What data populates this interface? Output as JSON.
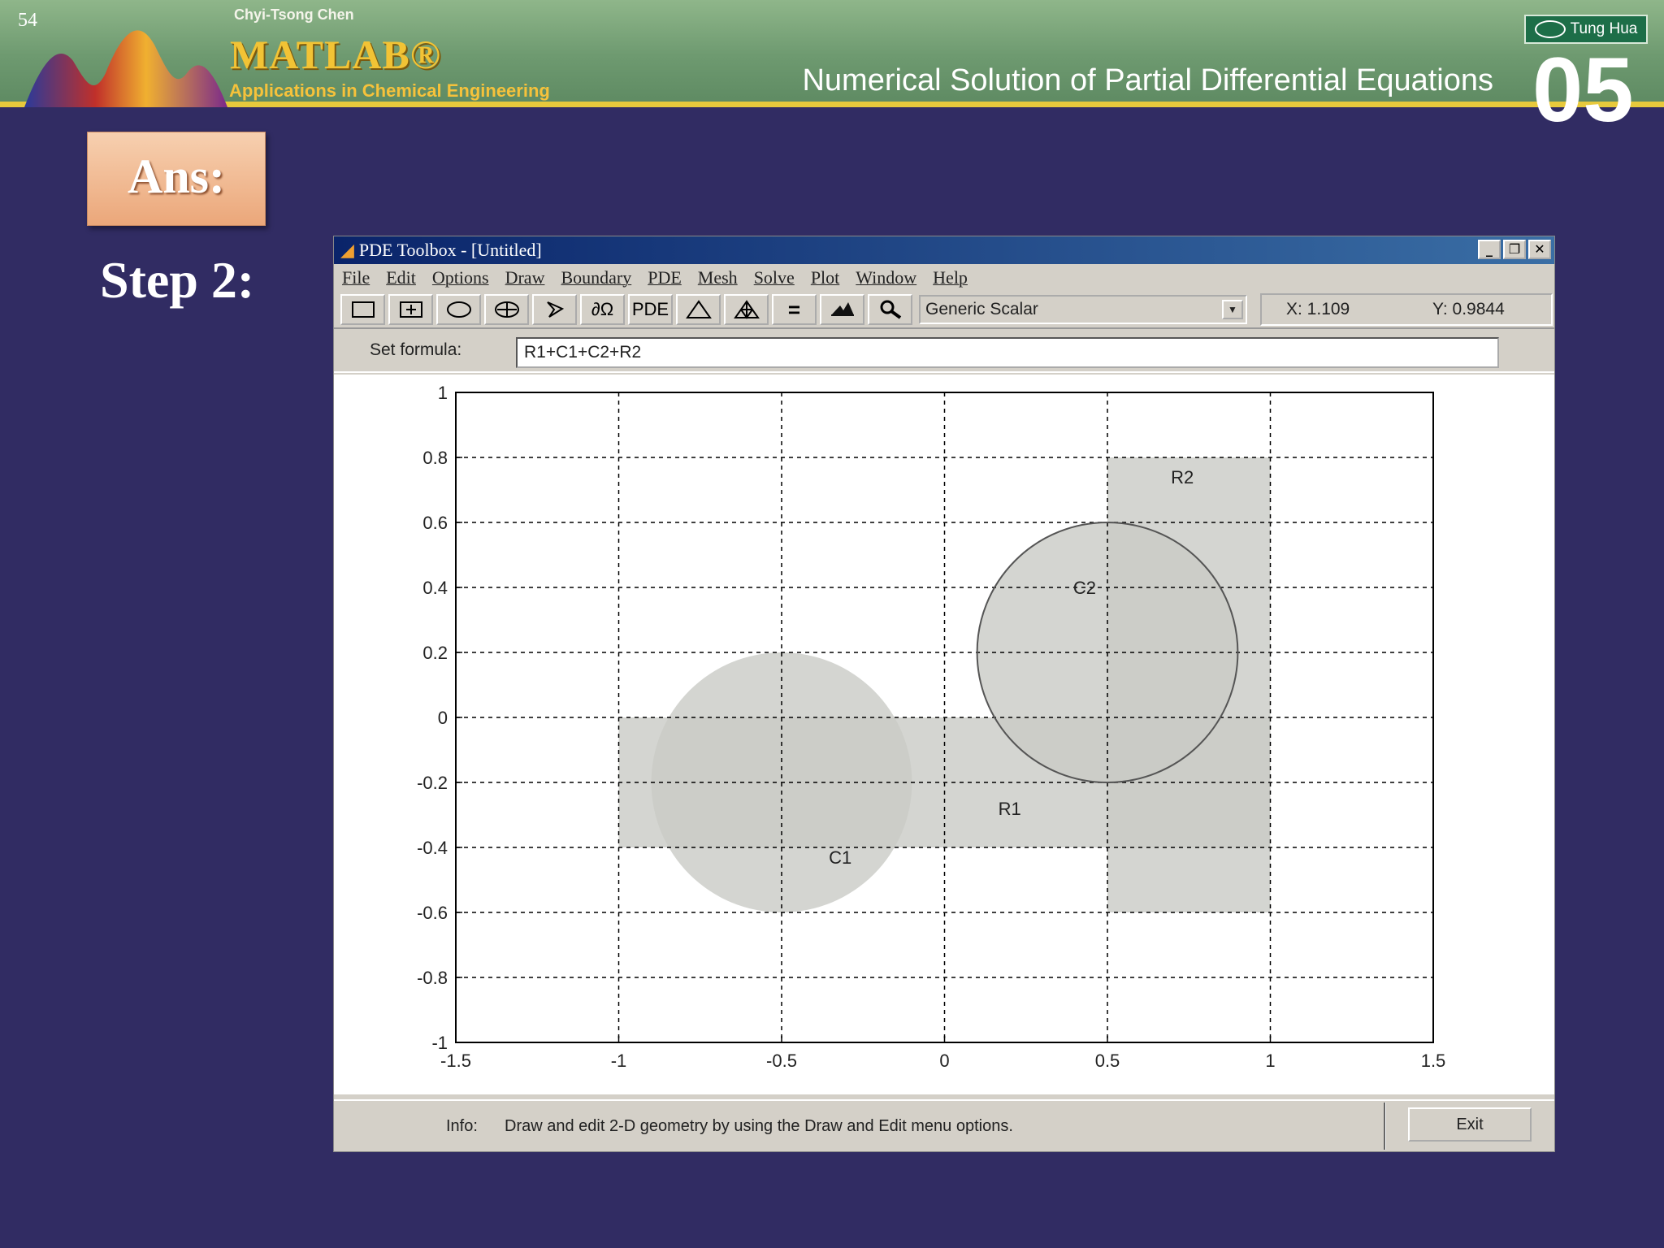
{
  "slide": {
    "page_number": "54",
    "author": "Chyi-Tsong Chen",
    "logo": "MATLAB®",
    "book_subtitle": "Applications in Chemical Engineering",
    "chapter_title": "Numerical Solution of Partial Differential Equations",
    "chapter_number": "05",
    "publisher": "Tung Hua",
    "ans_label": "Ans:",
    "step_label": "Step 2:"
  },
  "window": {
    "title": "PDE Toolbox - [Untitled]",
    "menu": [
      "File",
      "Edit",
      "Options",
      "Draw",
      "Boundary",
      "PDE",
      "Mesh",
      "Solve",
      "Plot",
      "Window",
      "Help"
    ],
    "toolbar": [
      {
        "icon": "rectangle-icon"
      },
      {
        "icon": "centered-rectangle-icon"
      },
      {
        "icon": "ellipse-icon"
      },
      {
        "icon": "centered-ellipse-icon"
      },
      {
        "icon": "polygon-icon"
      },
      {
        "icon": "boundary-mode-icon",
        "label": "∂Ω"
      },
      {
        "icon": "pde-spec-icon",
        "label": "PDE"
      },
      {
        "icon": "triangle-mesh-icon"
      },
      {
        "icon": "refine-mesh-icon"
      },
      {
        "icon": "solve-equals-icon",
        "label": "="
      },
      {
        "icon": "plot-3d-icon"
      },
      {
        "icon": "zoom-icon"
      }
    ],
    "application_mode": "Generic Scalar",
    "cursor_x": "X:  1.109",
    "cursor_y": "Y:  0.9844",
    "formula_label": "Set formula:",
    "formula_value": "R1+C1+C2+R2",
    "info_label": "Info:",
    "info_text": "Draw and edit 2-D geometry by using the Draw and Edit menu options.",
    "exit_label": "Exit"
  },
  "chart_data": {
    "type": "scatter",
    "xlim": [
      -1.5,
      1.5
    ],
    "ylim": [
      -1,
      1
    ],
    "x_ticks": [
      "-1.5",
      "-1",
      "-0.5",
      "0",
      "0.5",
      "1",
      "1.5"
    ],
    "y_ticks": [
      "-1",
      "-0.8",
      "-0.6",
      "-0.4",
      "-0.2",
      "0",
      "0.2",
      "0.4",
      "0.6",
      "0.8",
      "1"
    ],
    "grid": true,
    "shapes": [
      {
        "name": "R1",
        "kind": "rectangle",
        "x_range": [
          -1,
          1
        ],
        "y_range": [
          -0.4,
          0
        ],
        "label_at": [
          0.2,
          -0.3
        ]
      },
      {
        "name": "C1",
        "kind": "circle",
        "center": [
          -0.5,
          -0.2
        ],
        "radius": 0.4,
        "label_at": [
          -0.32,
          -0.45
        ]
      },
      {
        "name": "C2",
        "kind": "circle",
        "center": [
          0.5,
          0.2
        ],
        "radius": 0.4,
        "selected": true,
        "label_at": [
          0.43,
          0.38
        ]
      },
      {
        "name": "R2",
        "kind": "rectangle",
        "x_range": [
          0.5,
          1
        ],
        "y_range": [
          -0.6,
          0.8
        ],
        "label_at": [
          0.73,
          0.72
        ]
      }
    ],
    "colors": {
      "shape_fill": "#c9cbc6",
      "overlap_fill": "#bfc1bc",
      "outline": "#555555"
    }
  }
}
